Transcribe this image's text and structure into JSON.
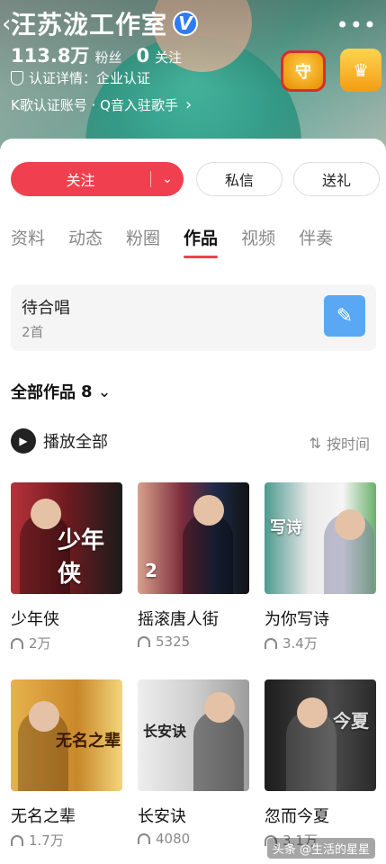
{
  "profile": {
    "name": "汪苏泷工作室",
    "verified_badge": "V",
    "fans_count": "113.8万",
    "fans_label": "粉丝",
    "following_count": "0",
    "following_label": "关注",
    "cert_text": "认证详情：企业认证",
    "k_account_text": "K歌认证账号 · Q音入驻歌手",
    "medal_1": "守"
  },
  "actions": {
    "follow_label": "关注",
    "message_label": "私信",
    "gift_label": "送礼"
  },
  "tabs": [
    {
      "label": "资料",
      "active": false
    },
    {
      "label": "动态",
      "active": false
    },
    {
      "label": "粉圈",
      "active": false
    },
    {
      "label": "作品",
      "active": true
    },
    {
      "label": "视频",
      "active": false
    },
    {
      "label": "伴奏",
      "active": false
    }
  ],
  "duet": {
    "title": "待合唱",
    "count": "2首"
  },
  "works": {
    "header_label": "全部作品",
    "count": "8",
    "play_all_label": "播放全部",
    "sort_label": "按时间",
    "items": [
      {
        "title": "少年侠",
        "plays": "2万",
        "cover_text": "少年侠"
      },
      {
        "title": "摇滚唐人街",
        "plays": "5325",
        "cover_text": "2"
      },
      {
        "title": "为你写诗",
        "plays": "3.4万",
        "cover_text": "写诗"
      },
      {
        "title": "无名之辈",
        "plays": "1.7万",
        "cover_text": "无名之辈"
      },
      {
        "title": "长安诀",
        "plays": "4080",
        "cover_text": "长安诀"
      },
      {
        "title": "忽而今夏",
        "plays": "3.1万",
        "cover_text": "今夏"
      }
    ]
  },
  "watermark": "头条 @生活的星星",
  "colors": {
    "accent": "#f0404f",
    "verified": "#2f7bf4",
    "duet_icon": "#5aa8f4"
  }
}
